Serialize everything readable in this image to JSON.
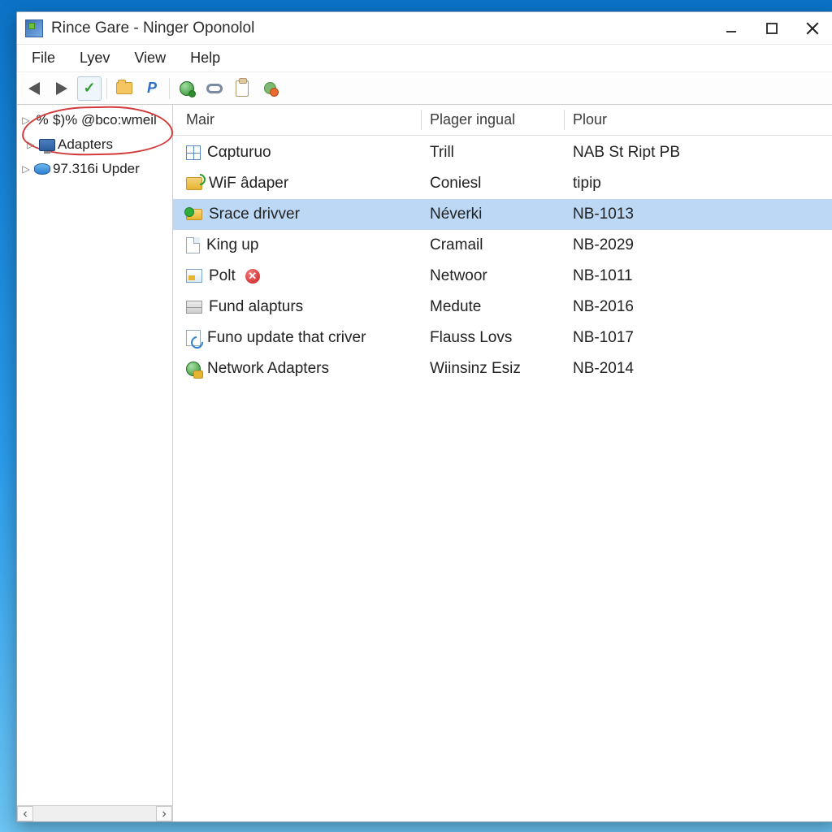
{
  "window": {
    "title": "Rince Gare - Ninger Oponolol"
  },
  "menu": {
    "file": "File",
    "lyev": "Lyev",
    "view": "View",
    "help": "Help"
  },
  "tree": {
    "items": [
      {
        "label": "$)% @bco:wmeil"
      },
      {
        "label": "Adapters"
      },
      {
        "label": "97.316i Upder"
      }
    ]
  },
  "columns": {
    "c0": "Mair",
    "c1": "Plager ingual",
    "c2": "Plour"
  },
  "rows": [
    {
      "name": "Cαpturuo",
      "c1": "Trill",
      "c2": "NAB St Ript PB",
      "icon": "grid"
    },
    {
      "name": "WiF âdaper",
      "c1": "Coniesl",
      "c2": "tipip",
      "icon": "wifi"
    },
    {
      "name": "Srace drivver",
      "c1": "Néverki",
      "c2": "NB-1013",
      "icon": "drive",
      "selected": true
    },
    {
      "name": "King up",
      "c1": "Cramail",
      "c2": "NB-2029",
      "icon": "page"
    },
    {
      "name": "Polt",
      "c1": "Netwoor",
      "c2": "NB-1011",
      "icon": "img",
      "error": true
    },
    {
      "name": "Fund alapturs",
      "c1": "Medute",
      "c2": "NB-2016",
      "icon": "panel"
    },
    {
      "name": "Funo update that criver",
      "c1": "Flauss Lovs",
      "c2": "NB-1017",
      "icon": "refresh"
    },
    {
      "name": "Network Adapters",
      "c1": "Wiinsinz Esiz",
      "c2": "NB-2014",
      "icon": "net"
    }
  ]
}
